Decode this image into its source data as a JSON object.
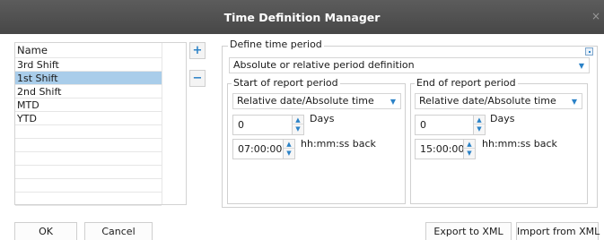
{
  "window": {
    "title": "Time Definition Manager",
    "close_glyph": "×"
  },
  "list": {
    "header": "Name",
    "items": [
      "3rd Shift",
      "1st Shift",
      "2nd Shift",
      "MTD",
      "YTD"
    ],
    "selected_index": 1
  },
  "side_buttons": {
    "add": "+",
    "remove": "−"
  },
  "define": {
    "group_label": "Define time period",
    "period_type": "Absolute or relative period definition"
  },
  "start": {
    "group_label": "Start of report period",
    "mode": "Relative date/Absolute time",
    "days_value": "0",
    "days_unit": "Days",
    "time_value": "07:00:00",
    "time_unit": "hh:mm:ss back"
  },
  "end": {
    "group_label": "End of report period",
    "mode": "Relative date/Absolute time",
    "days_value": "0",
    "days_unit": "Days",
    "time_value": "15:00:00",
    "time_unit": "hh:mm:ss back"
  },
  "footer": {
    "ok": "OK",
    "cancel": "Cancel",
    "export": "Export to XML",
    "import": "Import from XML"
  },
  "colors": {
    "titlebar": "#4f4f4f",
    "accent": "#2b82c7",
    "selection": "#a9cdea"
  }
}
